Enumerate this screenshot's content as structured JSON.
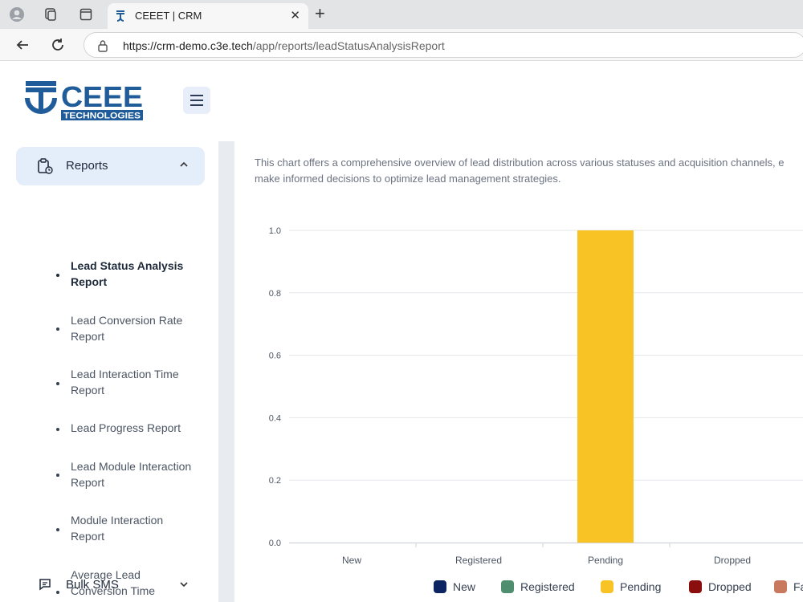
{
  "browser": {
    "tab_title": "CEEET | CRM",
    "url_host": "https://crm-demo.c3e.tech",
    "url_path": "/app/reports/leadStatusAnalysisReport"
  },
  "brand": {
    "logo_text": "CEEE",
    "logo_sub": "TECHNOLOGIES",
    "color": "#1f5c99"
  },
  "sidebar": {
    "reports_label": "Reports",
    "items": [
      {
        "label": "Lead Status Analysis Report",
        "active": true
      },
      {
        "label": "Lead Conversion Rate Report"
      },
      {
        "label": "Lead Interaction Time Report"
      },
      {
        "label": "Lead Progress Report"
      },
      {
        "label": "Lead Module Interaction Report"
      },
      {
        "label": "Module Interaction Report"
      },
      {
        "label": "Average Lead Conversion Time Report"
      }
    ],
    "bulk_sms_label": "Bulk SMS"
  },
  "main": {
    "description_line1": "This chart offers a comprehensive overview of lead distribution across various statuses and acquisition channels, e",
    "description_line2": "make informed decisions to optimize lead management strategies."
  },
  "chart_data": {
    "type": "bar",
    "categories": [
      "New",
      "Registered",
      "Pending",
      "Dropped"
    ],
    "values": [
      0,
      0,
      1,
      0
    ],
    "ylim": [
      0,
      1
    ],
    "yticks": [
      "0.0",
      "0.2",
      "0.4",
      "0.6",
      "0.8",
      "1.0"
    ],
    "grid": true,
    "legend": [
      {
        "name": "New",
        "color": "#0c2461"
      },
      {
        "name": "Registered",
        "color": "#4f8f6f"
      },
      {
        "name": "Pending",
        "color": "#f7c325"
      },
      {
        "name": "Dropped",
        "color": "#8b0e0e"
      },
      {
        "name": "Fa",
        "color": "#c97a5e"
      }
    ],
    "bar_colors": [
      "#0c2461",
      "#4f8f6f",
      "#f7c325",
      "#8b0e0e"
    ]
  }
}
